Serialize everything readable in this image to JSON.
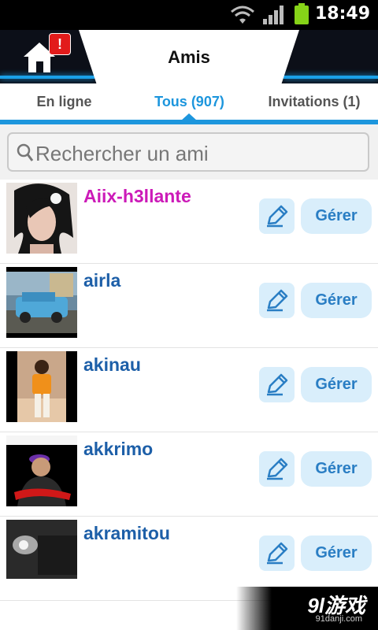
{
  "status_bar": {
    "time": "18:49",
    "icons": [
      "wifi-icon",
      "signal-icon",
      "battery-icon"
    ]
  },
  "header": {
    "title": "Amis",
    "home_icon": "home-icon",
    "badge": "!"
  },
  "tabs": [
    {
      "label": "En ligne",
      "active": false
    },
    {
      "label": "Tous (907)",
      "active": true
    },
    {
      "label": "Invitations (1)",
      "active": false
    }
  ],
  "search": {
    "placeholder": "Rechercher un ami"
  },
  "friends": [
    {
      "name": "Aiix-h3llante",
      "manage_label": "Gérer"
    },
    {
      "name": "airla",
      "manage_label": "Gérer"
    },
    {
      "name": "akinau",
      "manage_label": "Gérer"
    },
    {
      "name": "akkrimo",
      "manage_label": "Gérer"
    },
    {
      "name": "akramitou",
      "manage_label": "Gérer"
    }
  ],
  "watermark": {
    "main": "9l游戏",
    "sub": "91danji.com"
  },
  "colors": {
    "accent": "#1d96dd",
    "name": "#1d5fa8",
    "highlight_name": "#cc1ab8",
    "button_bg": "#d9eefb"
  }
}
